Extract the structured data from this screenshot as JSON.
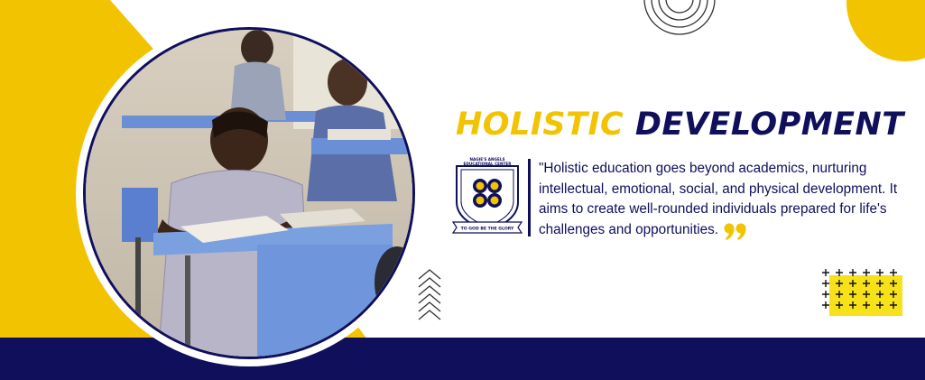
{
  "heading": {
    "word1": "HOLISTIC",
    "word2": "DEVELOPMENT"
  },
  "quote": {
    "text": "\"Holistic education goes beyond academics, nurturing intellectual, emotional, social, and physical development. It aims to create well-rounded individuals prepared for life's challenges and opportunities."
  },
  "logo": {
    "name_line1": "NAGIE'S ANGELS",
    "name_line2": "EDUCATIONAL CENTER",
    "motto": "TO GOD BE THE GLORY"
  },
  "icons": {
    "quote": "closing-quote-icon",
    "chevrons": "chevrons-up-icon",
    "rings": "concentric-rings-decoration",
    "plus_grid": "plus-pattern-decoration"
  },
  "colors": {
    "navy": "#0f0f5c",
    "yellow": "#f2c300",
    "light_yellow": "#f7e11a",
    "white": "#ffffff"
  }
}
